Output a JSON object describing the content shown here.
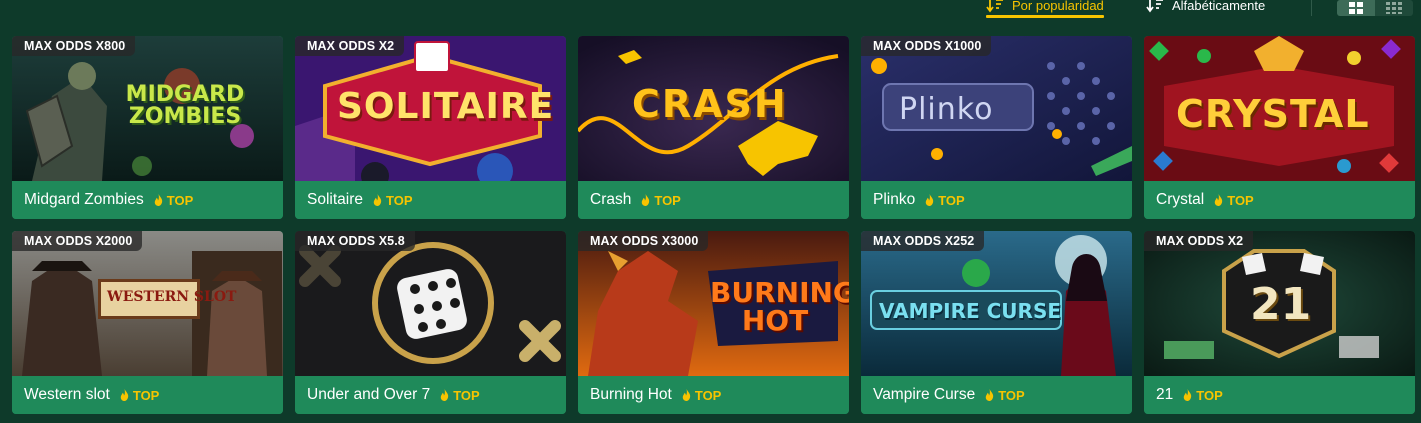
{
  "sort": {
    "popular_label": "Por popularidad",
    "alpha_label": "Alfabéticamente",
    "active": "popular"
  },
  "view": {
    "active": "large-grid"
  },
  "colors": {
    "background": "#0e3a2a",
    "card": "#1f8a5a",
    "accent": "#f7c400",
    "badge": "#282828"
  },
  "games": [
    {
      "name": "Midgard Zombies",
      "badge": "MAX ODDS X800",
      "tag": "TOP",
      "art": "MIDGARD ZOMBIES"
    },
    {
      "name": "Solitaire",
      "badge": "MAX ODDS X2",
      "tag": "TOP",
      "art": "SOLITAIRE"
    },
    {
      "name": "Crash",
      "badge": "",
      "tag": "TOP",
      "art": "CRASH"
    },
    {
      "name": "Plinko",
      "badge": "MAX ODDS X1000",
      "tag": "TOP",
      "art": "Plinko"
    },
    {
      "name": "Crystal",
      "badge": "",
      "tag": "TOP",
      "art": "CRYSTAL"
    },
    {
      "name": "Western slot",
      "badge": "MAX ODDS X2000",
      "tag": "TOP",
      "art": "WESTERN SLOT"
    },
    {
      "name": "Under and Over 7",
      "badge": "MAX ODDS X5.8",
      "tag": "TOP",
      "art": ""
    },
    {
      "name": "Burning Hot",
      "badge": "MAX ODDS X3000",
      "tag": "TOP",
      "art": "BURNING HOT"
    },
    {
      "name": "Vampire Curse",
      "badge": "MAX ODDS X252",
      "tag": "TOP",
      "art": "VAMPIRE CURSE"
    },
    {
      "name": "21",
      "badge": "MAX ODDS X2",
      "tag": "TOP",
      "art": "21"
    }
  ]
}
